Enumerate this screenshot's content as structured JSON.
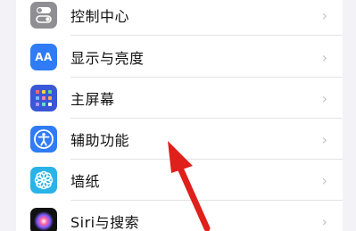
{
  "settings": {
    "items": [
      {
        "label": "控制中心",
        "icon": "control-center-icon",
        "icon_color": "#8e8e93"
      },
      {
        "label": "显示与亮度",
        "icon": "display-brightness-icon",
        "icon_color": "#2f7cf6",
        "icon_text": "AA"
      },
      {
        "label": "主屏幕",
        "icon": "home-screen-icon",
        "icon_color": "#3a57d8"
      },
      {
        "label": "辅助功能",
        "icon": "accessibility-icon",
        "icon_color": "#2f7cf6"
      },
      {
        "label": "墙纸",
        "icon": "wallpaper-icon",
        "icon_color": "#2bb3e8"
      },
      {
        "label": "Siri与搜索",
        "icon": "siri-icon",
        "icon_color": "#111111"
      }
    ],
    "chevron": "›"
  },
  "annotation": {
    "arrow_color": "#e0201a",
    "icon": "red-pointer-arrow"
  }
}
